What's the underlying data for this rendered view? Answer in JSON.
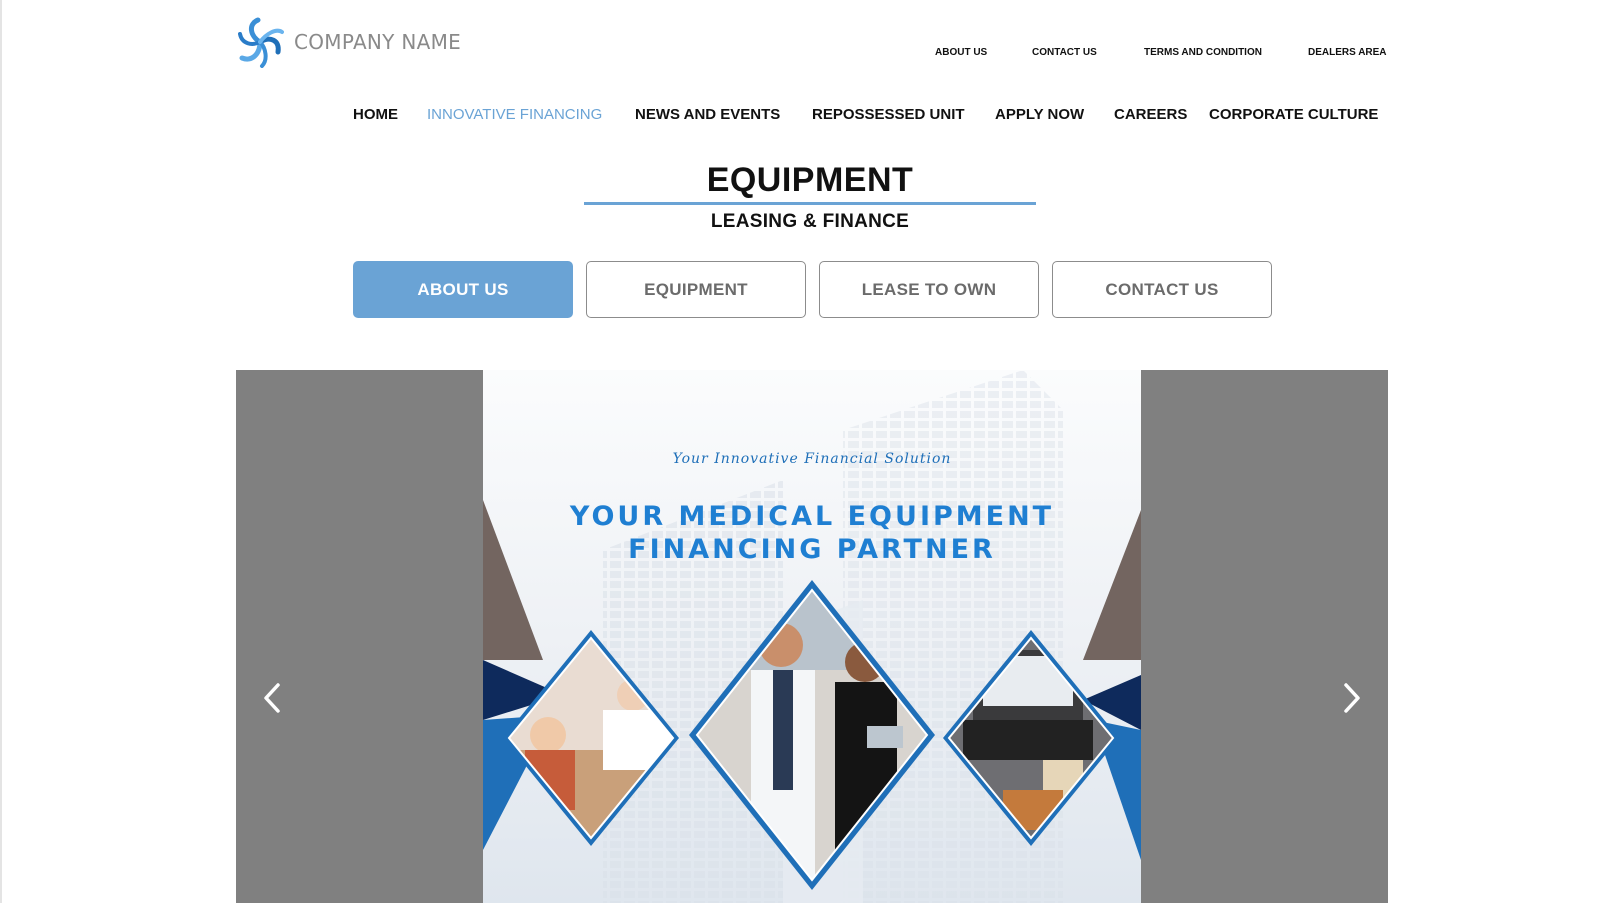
{
  "header": {
    "company_name": "COMPANY NAME",
    "logo_icon": "swirl-logo-icon"
  },
  "top_links": [
    "ABOUT US",
    "CONTACT US",
    "TERMS AND CONDITION",
    "DEALERS AREA"
  ],
  "main_nav": {
    "items": [
      "HOME",
      "INNOVATIVE FINANCING",
      "NEWS AND EVENTS",
      "REPOSSESSED UNIT",
      "APPLY NOW",
      "CAREERS",
      "CORPORATE CULTURE"
    ],
    "active": "INNOVATIVE FINANCING"
  },
  "page_title": {
    "main": "EQUIPMENT",
    "sub": "LEASING & FINANCE"
  },
  "tabs": {
    "items": [
      "ABOUT  US",
      "EQUIPMENT",
      "LEASE TO OWN",
      "CONTACT  US"
    ],
    "active": "ABOUT  US"
  },
  "carousel": {
    "prev_icon": "chevron-left-icon",
    "next_icon": "chevron-right-icon",
    "slide": {
      "tagline": "Your Innovative Financial Solution",
      "headline_line1": "YOUR MEDICAL EQUIPMENT",
      "headline_line2": "FINANCING PARTNER"
    }
  },
  "colors": {
    "accent": "#6aa3d5",
    "banner_blue": "#1f7fd2",
    "carousel_bg": "#808080",
    "navy": "#0e2a5c",
    "taupe": "#736560"
  }
}
